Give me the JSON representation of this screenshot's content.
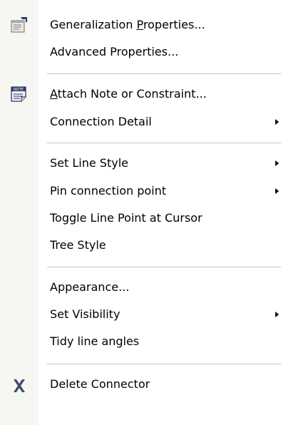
{
  "menu": {
    "icons": {
      "generalization": "properties-icon",
      "note": "note-icon",
      "delete": "delete-x-icon"
    },
    "items": [
      {
        "label": "Generalization Properties...",
        "mnemonic": "P",
        "submenu": false
      },
      {
        "label": "Advanced Properties...",
        "submenu": false
      },
      {
        "label": "Attach Note or Constraint...",
        "mnemonic": "A",
        "submenu": false
      },
      {
        "label": "Connection Detail",
        "submenu": true
      },
      {
        "label": "Set Line Style",
        "submenu": true
      },
      {
        "label": "Pin connection point",
        "submenu": true
      },
      {
        "label": "Toggle Line Point at Cursor",
        "submenu": false
      },
      {
        "label": "Tree Style",
        "submenu": false
      },
      {
        "label": "Appearance...",
        "submenu": false
      },
      {
        "label": "Set Visibility",
        "submenu": true
      },
      {
        "label": "Tidy line angles",
        "submenu": false
      },
      {
        "label": "Delete Connector",
        "submenu": false
      }
    ]
  },
  "colors": {
    "gutter": "#f6f6f2",
    "separator": "#c7c5b2",
    "delete_icon": "#3f4b6e"
  }
}
